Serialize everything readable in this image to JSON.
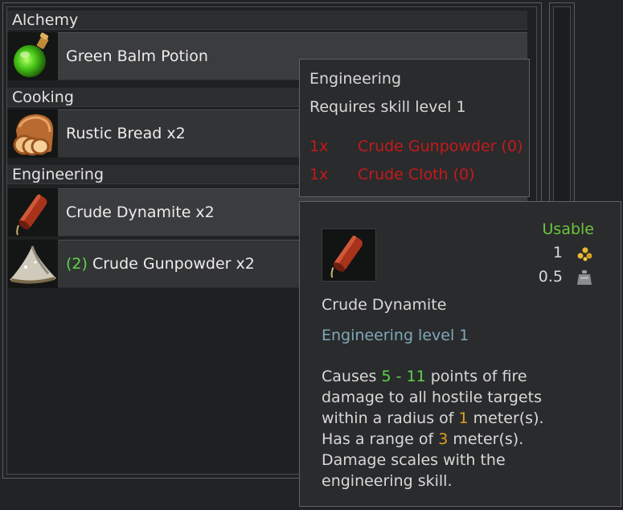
{
  "categories": [
    {
      "name": "Alchemy"
    },
    {
      "name": "Cooking"
    },
    {
      "name": "Engineering"
    }
  ],
  "recipes": [
    {
      "name": "Green Balm Potion",
      "icon": "green-potion-icon"
    },
    {
      "name": "Rustic Bread x2",
      "icon": "bread-icon"
    },
    {
      "name": "Crude Dynamite x2",
      "icon": "dynamite-icon"
    },
    {
      "count": "(2)",
      "name": "Crude Gunpowder x2",
      "icon": "gunpowder-icon"
    }
  ],
  "requirements_tooltip": {
    "skill": "Engineering",
    "requirement": "Requires skill level 1",
    "ingredients": [
      {
        "qty": "1x",
        "name": "Crude Gunpowder (0)"
      },
      {
        "qty": "1x",
        "name": "Crude Cloth (0)"
      }
    ]
  },
  "item_tooltip": {
    "usable": "Usable",
    "value": "1",
    "weight": "0.5",
    "name": "Crude Dynamite",
    "skill_level": "Engineering level 1",
    "desc": {
      "a": "Causes ",
      "dmg_min": "5",
      "dash": " - ",
      "dmg_max": "11",
      "b": " points of fire",
      "line2": "damage to all hostile targets",
      "c": "within a radius of ",
      "radius": "1",
      "d": " meter(s).",
      "e": "Has a range of ",
      "range": "3",
      "f": " meter(s).",
      "line5": "Damage scales with the",
      "line6": "engineering skill."
    }
  },
  "colors": {
    "requirement_missing": "#c41a1a",
    "usable": "#6cc43c",
    "skill": "#7fa8b8",
    "damage": "#5cd64a",
    "numeric": "#e0a020"
  }
}
